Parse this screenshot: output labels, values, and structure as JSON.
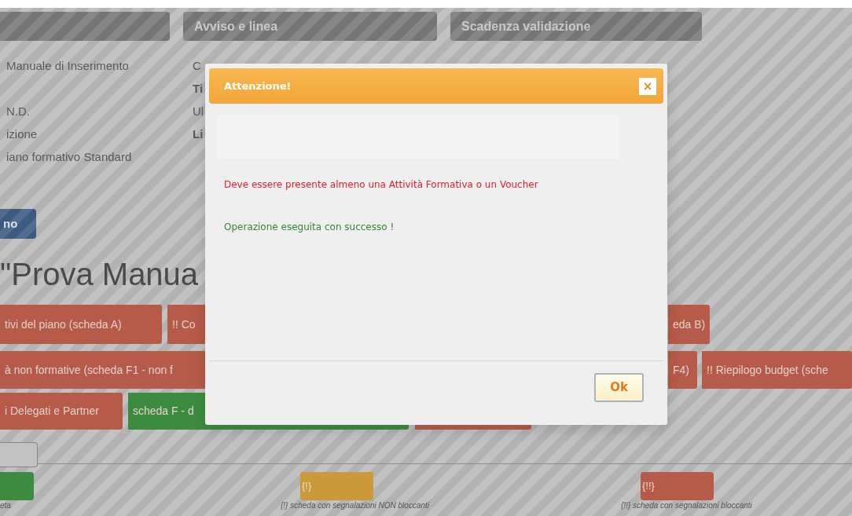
{
  "header_tabs": [
    {
      "label": "Avviso e linea"
    },
    {
      "label": "Scadenza validazione"
    }
  ],
  "info_rows": [
    {
      "left": "Manuale di Inserimento",
      "right": "C",
      "right_bold": false
    },
    {
      "right": "Ti",
      "right_bold": true
    },
    {
      "left": "N.D.",
      "right": "Ul",
      "right_bold": false
    },
    {
      "left": "izione",
      "right": "Li",
      "right_bold": true
    },
    {
      "left": "iano formativo Standard"
    }
  ],
  "action_button": "no",
  "heading": "\"Prova Manua",
  "tile_rows": [
    [
      {
        "label": "tivi del piano (scheda A)",
        "color": "#b65a49"
      },
      {
        "label": "!!  Co",
        "color": "#b65a49"
      },
      {
        "label": "eda B)",
        "color": "#b65a49"
      }
    ],
    [
      {
        "label": "à non formative (scheda F1 - non f",
        "color": "#b65a49"
      },
      {
        "label": "F4)",
        "color": "#b65a49"
      },
      {
        "label": "!!  Riepilogo budget (sche",
        "color": "#b65a49"
      }
    ],
    [
      {
        "label": "i Delegati e Partner",
        "color": "#b65a49"
      },
      {
        "label": "scheda F - d",
        "color": "#3d8b40"
      },
      {
        "color": "#b65a49"
      }
    ]
  ],
  "legend": [
    {
      "color": "#3d8b40",
      "caption": "eta"
    },
    {
      "color": "#c9993a",
      "badge": "{!}",
      "caption": "{!} scheda con segnalazioni NON bloccanti"
    },
    {
      "color": "#b65a49",
      "badge": "{!!}",
      "caption": "{!!} scheda con segnalazioni bloccanti"
    }
  ],
  "dialog": {
    "title": "Attenzione!",
    "close": "×",
    "messages": [
      {
        "kind": "error",
        "text": "Deve essere presente almeno una Attività Formativa o un Voucher"
      },
      {
        "kind": "success",
        "text": "Operazione eseguita con successo !"
      }
    ],
    "ok_button": "Ok"
  }
}
